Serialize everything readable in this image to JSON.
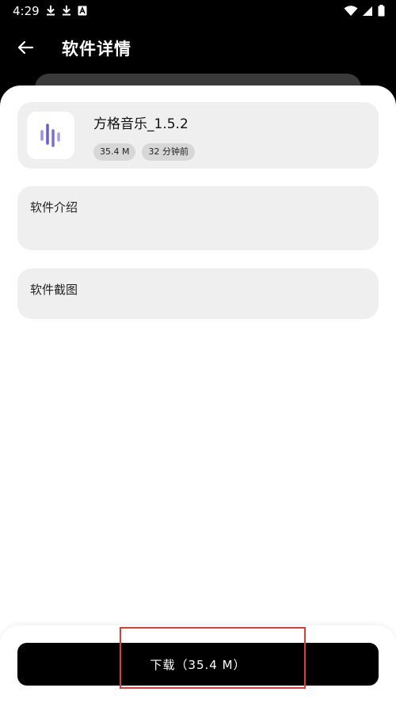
{
  "status_bar": {
    "time": "4:29"
  },
  "header": {
    "title": "软件详情"
  },
  "app": {
    "name": "方格音乐_1.5.2",
    "size": "35.4 M",
    "updated": "32 分钟前"
  },
  "sections": {
    "intro_title": "软件介绍",
    "screenshots_title": "软件截图"
  },
  "download": {
    "label": "下载（35.4 M）"
  },
  "colors": {
    "header_bg": "#000000",
    "card_bg": "#efefef",
    "badge_bg": "#d7d7d7",
    "button_bg": "#000000",
    "icon_accent": "#7b6fd9",
    "highlight": "#e53935"
  },
  "icons": {
    "back": "arrow-left-icon",
    "app": "sound-wave-icon",
    "status_left": [
      "download-icon",
      "download-icon",
      "a-box-icon"
    ],
    "status_right": [
      "wifi-icon",
      "signal-icon",
      "battery-icon"
    ]
  }
}
